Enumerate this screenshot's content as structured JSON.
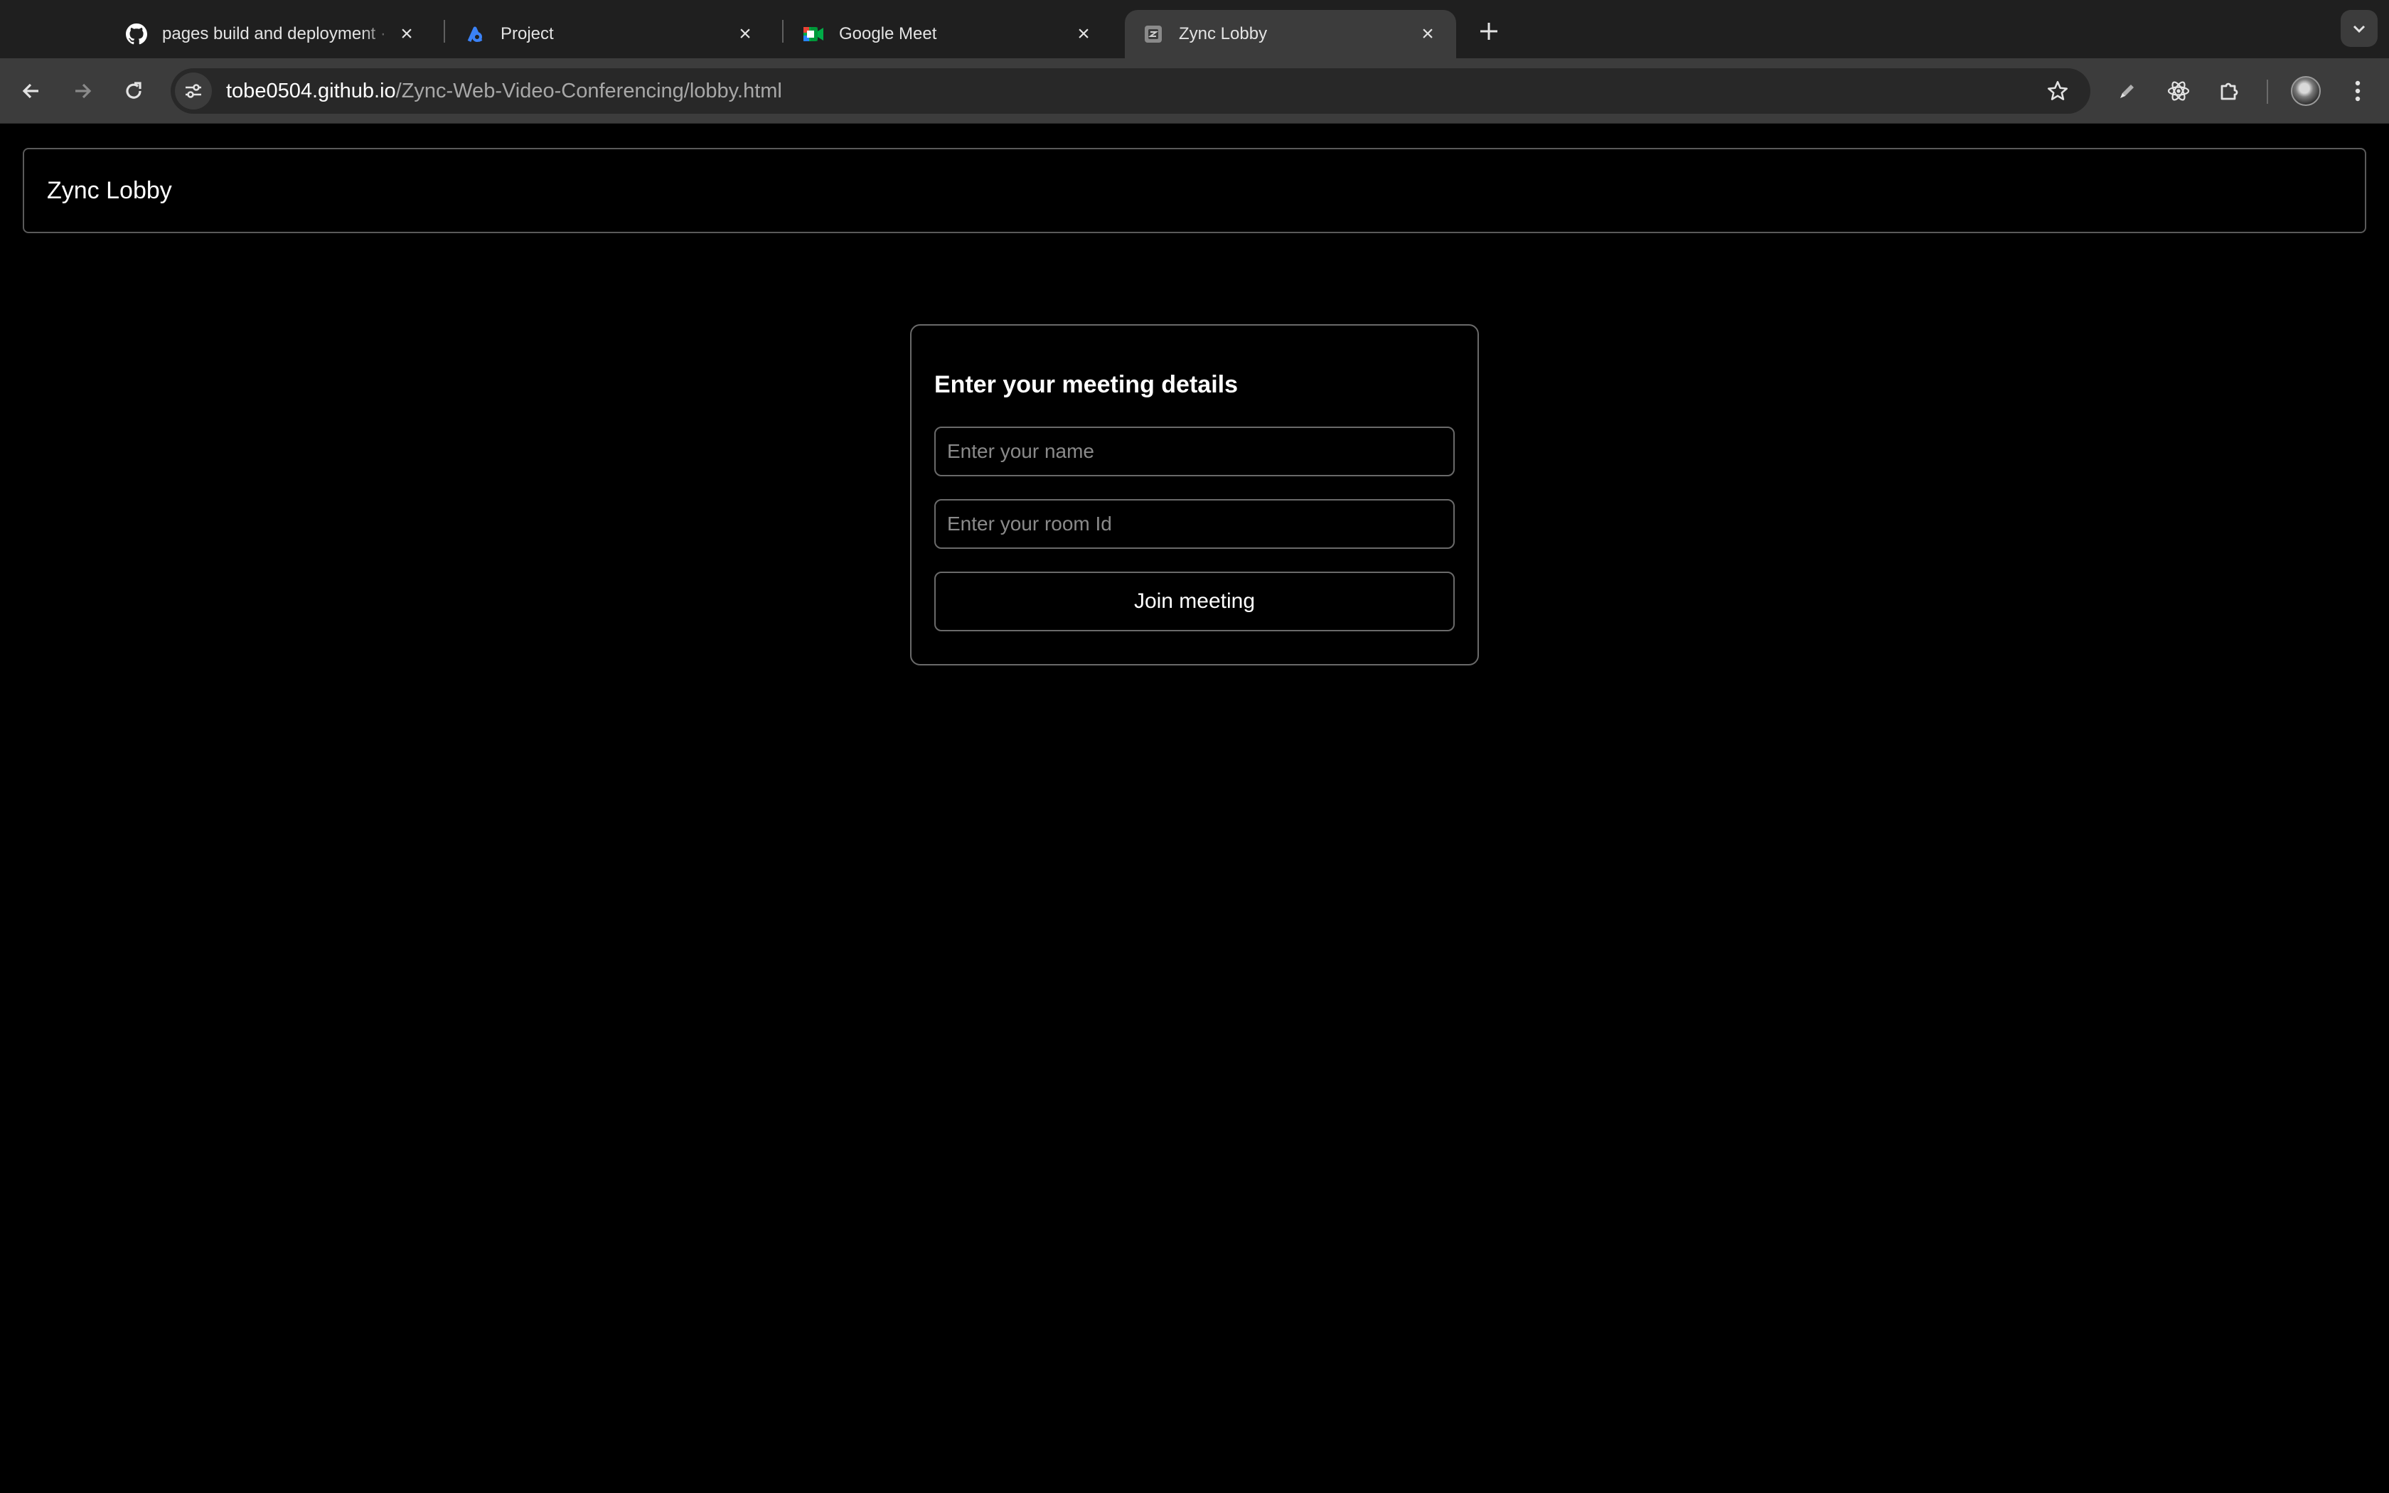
{
  "browser": {
    "tabs": [
      {
        "title": "pages build and deployment · ",
        "icon": "github-icon",
        "active": false
      },
      {
        "title": "Project",
        "icon": "appwrite-icon",
        "active": false
      },
      {
        "title": "Google Meet",
        "icon": "google-meet-icon",
        "active": false
      },
      {
        "title": "Zync Lobby",
        "icon": "zync-favicon",
        "active": true
      }
    ],
    "url_host": "tobe0504.github.io",
    "url_path": "/Zync-Web-Video-Conferencing/lobby.html"
  },
  "page": {
    "header": {
      "brand": "Zync Lobby"
    },
    "form": {
      "heading": "Enter your meeting details",
      "name_placeholder": "Enter your name",
      "name_value": "",
      "room_placeholder": "Enter your room Id",
      "room_value": "",
      "join_label": "Join meeting"
    }
  },
  "colors": {
    "background": "#000000",
    "border": "#6a6a6a",
    "text": "#ffffff",
    "placeholder": "#8a8a8a"
  }
}
